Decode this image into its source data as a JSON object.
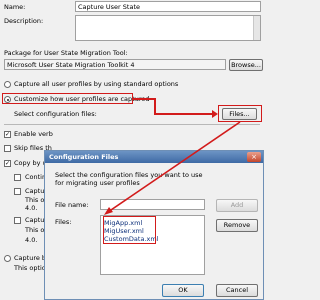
{
  "form": {
    "name_label": "Name:",
    "name_value": "Capture User State",
    "description_label": "Description:",
    "package_label": "Package for User State Migration Tool:",
    "package_value": "Microsoft User State Migration Toolkit 4",
    "browse_label": "Browse...",
    "radio_standard_label": "Capture all user profiles by using standard options",
    "radio_customize_label": "Customize how user profiles are captured",
    "select_files_label": "Select configuration files:",
    "files_label": "Files...",
    "enable_verbose_label": "Enable verb",
    "skip_files_label": "Skip files th",
    "copy_by_using_label": "Copy by usin",
    "continue_label": "Contin",
    "capture1_label": "Captur",
    "capture1_note": "This o",
    "capture1_version": "4.0.",
    "capture2_label": "Captur",
    "capture2_note": "This o",
    "capture2_version": "4.0.",
    "capture_by_label": "Capture by u",
    "capture_by_note": "This optio"
  },
  "dialog": {
    "title": "Configuration Files",
    "close_glyph": "×",
    "instructions": "Select the configuration files you want to use for migrating user profiles",
    "file_name_label": "File name:",
    "file_name_value": "",
    "add_label": "Add",
    "files_list_label": "Files:",
    "files": [
      "MigApp.xml",
      "MigUser.xml",
      "CustomData.xml"
    ],
    "remove_label": "Remove",
    "ok_label": "OK",
    "cancel_label": "Cancel"
  },
  "colors": {
    "highlight": "#d21b1b",
    "titlebar": "#3e6aa5"
  }
}
